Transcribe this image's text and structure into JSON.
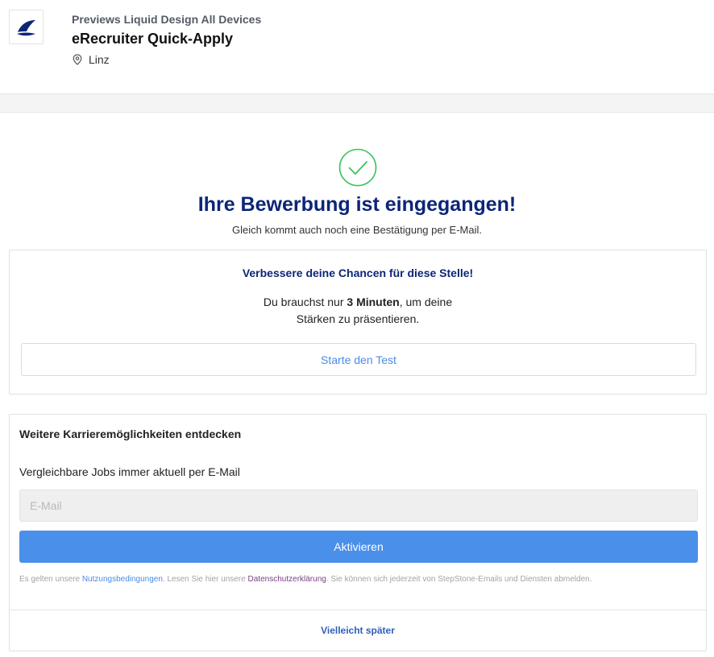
{
  "header": {
    "logo_icon": "sail-logo-icon",
    "company": "Previews Liquid Design All Devices",
    "job_title": "eRecruiter Quick-Apply",
    "location_icon": "location-pin-icon",
    "location": "Linz"
  },
  "success": {
    "icon": "check-circle-icon",
    "title": "Ihre Bewerbung ist eingegangen!",
    "subtitle": "Gleich kommt auch noch eine Bestätigung per E-Mail."
  },
  "improve_card": {
    "title": "Verbessere deine Chancen für diese Stelle!",
    "text_before": "Du brauchst nur ",
    "text_bold": "3 Minuten",
    "text_after_line1": ", um deine",
    "text_line2": "Stärken zu präsentieren.",
    "button_label": "Starte den Test"
  },
  "career_card": {
    "title": "Weitere Karrieremöglichkeiten entdecken",
    "label": "Vergleichbare Jobs immer aktuell per E-Mail",
    "email_value": "",
    "email_placeholder": "E-Mail",
    "activate_label": "Aktivieren",
    "terms_1": "Es gelten unsere ",
    "terms_link_1": "Nutzungsbedingungen",
    "terms_2": ". Lesen Sie hier unsere ",
    "terms_link_2": "Datenschutzerklärung",
    "terms_3": ". Sie können sich jederzeit von StepStone-Emails und Diensten abmelden.",
    "later_label": "Vielleicht später"
  },
  "colors": {
    "title_navy": "#0c2577",
    "success_green": "#3cc35a",
    "primary_blue": "#4a8fea",
    "link_blue": "#4a8ce8",
    "link_purple": "#7a3f86"
  }
}
